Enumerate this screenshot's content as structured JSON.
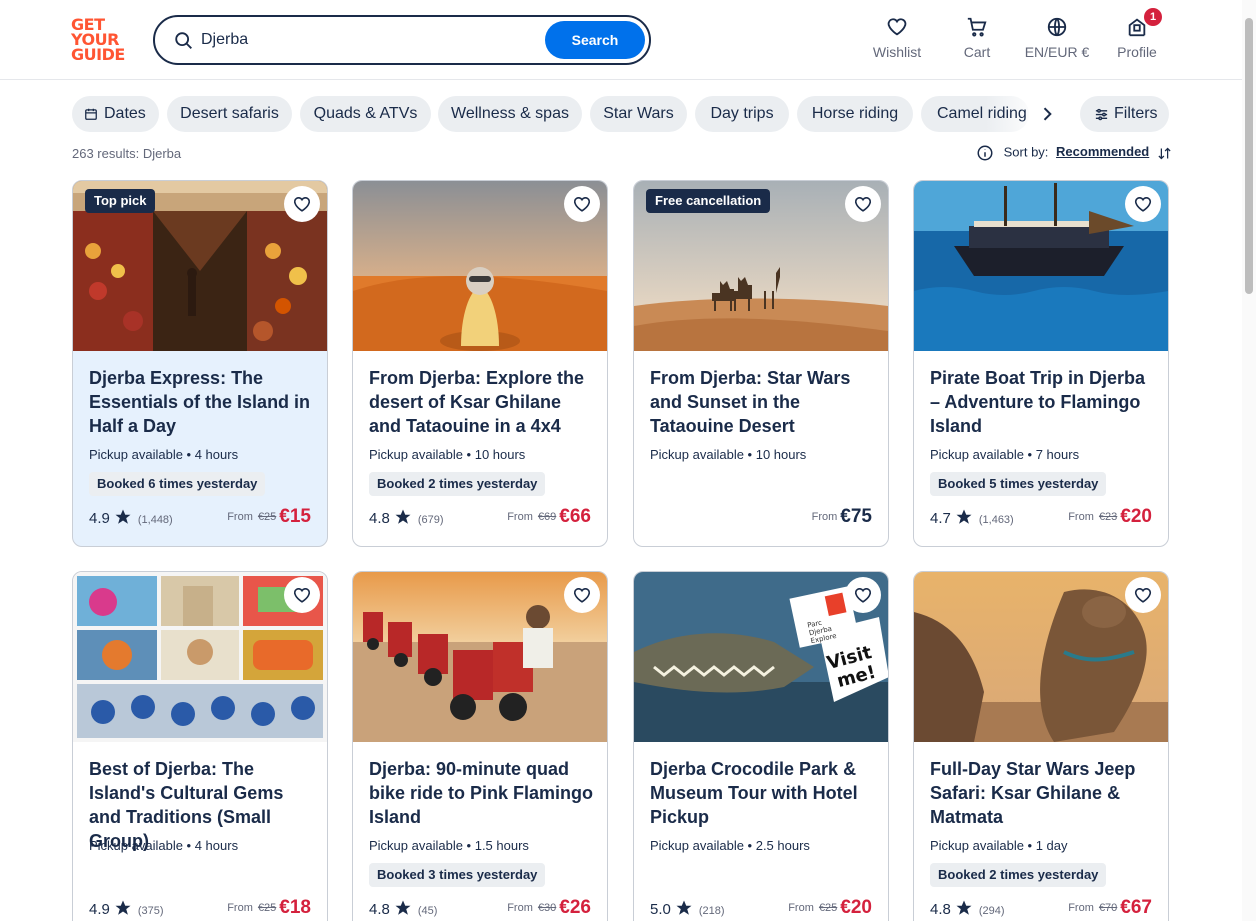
{
  "header": {
    "logo_lines": [
      "GET",
      "YOUR",
      "GUIDE"
    ],
    "search_value": "Djerba",
    "search_button": "Search",
    "nav": [
      {
        "label": "Wishlist",
        "icon": "heart-icon"
      },
      {
        "label": "Cart",
        "icon": "cart-icon"
      },
      {
        "label": "EN/EUR €",
        "icon": "globe-icon"
      },
      {
        "label": "Profile",
        "icon": "profile-icon",
        "badge": "1"
      }
    ]
  },
  "chips": [
    "Dates",
    "Desert safaris",
    "Quads & ATVs",
    "Wellness & spas",
    "Star Wars",
    "Day trips",
    "Horse riding",
    "Camel riding",
    "Filters"
  ],
  "results": {
    "count_text": "263 results: Djerba",
    "sort_label": "Sort by:",
    "sort_value": "Recommended"
  },
  "colors": {
    "brand": "#ff5533",
    "primary_button": "#0071eb",
    "price_sale": "#d4213d",
    "text": "#1a2b49",
    "highlight_card": "#e6f1fd"
  },
  "cards": [
    {
      "title": "Djerba Express: The Essentials of the Island in Half a Day",
      "meta": "Pickup available • 4 hours",
      "booked": "Booked 6 times yesterday",
      "rating": "4.9",
      "reviews": "(1,448)",
      "from": "From",
      "old_price": "€25",
      "price": "€15",
      "label": "Top pick"
    },
    {
      "title": "From Djerba: Explore the desert of Ksar Ghilane and Tataouine in a 4x4",
      "meta": "Pickup available • 10 hours",
      "booked": "Booked 2 times yesterday",
      "rating": "4.8",
      "reviews": "(679)",
      "from": "From",
      "old_price": "€69",
      "price": "€66"
    },
    {
      "title": "From Djerba: Star Wars and Sunset in the Tataouine Desert",
      "meta": "Pickup available • 10 hours",
      "from": "From",
      "price": "€75",
      "label": "Free cancellation"
    },
    {
      "title": "Pirate Boat Trip in Djerba – Adventure to Flamingo Island",
      "meta": "Pickup available • 7 hours",
      "booked": "Booked 5 times yesterday",
      "rating": "4.7",
      "reviews": "(1,463)",
      "from": "From",
      "old_price": "€23",
      "price": "€20"
    },
    {
      "title": "Best of Djerba: The Island's Cultural Gems and Traditions (Small Group)",
      "meta": "Pickup available • 4 hours",
      "rating": "4.9",
      "reviews": "(375)",
      "from": "From",
      "old_price": "€25",
      "price": "€18"
    },
    {
      "title": "Djerba: 90-minute quad bike ride to Pink Flamingo Island",
      "meta": "Pickup available • 1.5 hours",
      "booked": "Booked 3 times yesterday",
      "rating": "4.8",
      "reviews": "(45)",
      "from": "From",
      "old_price": "€30",
      "price": "€26"
    },
    {
      "title": "Djerba Crocodile Park & Museum Tour with Hotel Pickup",
      "meta": "Pickup available • 2.5 hours",
      "rating": "5.0",
      "reviews": "(218)",
      "from": "From",
      "old_price": "€25",
      "price": "€20",
      "image_sign": [
        "Parc",
        "Djerba",
        "Explore",
        "Visit",
        "me!"
      ]
    },
    {
      "title": "Full-Day Star Wars Jeep Safari: Ksar Ghilane & Matmata",
      "meta": "Pickup available • 1 day",
      "booked": "Booked 2 times yesterday",
      "rating": "4.8",
      "reviews": "(294)",
      "from": "From",
      "old_price": "€70",
      "price": "€67"
    }
  ]
}
